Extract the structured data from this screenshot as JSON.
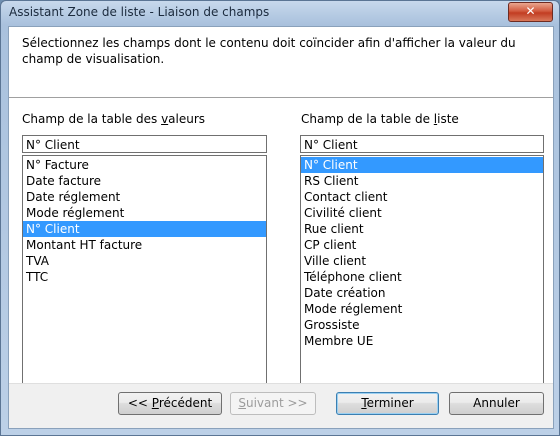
{
  "window": {
    "title": "Assistant Zone de liste - Liaison de champs",
    "close_glyph": "✕"
  },
  "description": "Sélectionnez les champs dont le contenu doit coïncider afin d'afficher la valeur du champ de visualisation.",
  "left": {
    "label_pre": "Champ de la table des ",
    "label_u": "v",
    "label_post": "aleurs",
    "field_value": "N° Client",
    "items": [
      "N° Facture",
      "Date facture",
      "Date réglement",
      "Mode réglement",
      "N° Client",
      "Montant HT facture",
      "TVA",
      "TTC"
    ],
    "selected_index": 4
  },
  "right": {
    "label_pre": "Champ de la table de ",
    "label_u": "l",
    "label_post": "iste",
    "field_value": "N° Client",
    "items": [
      "N° Client",
      "RS Client",
      "Contact client",
      "Civilité client",
      "Rue client",
      "CP client",
      "Ville client",
      "Téléphone client",
      "Date création",
      "Mode réglement",
      "Grossiste",
      "Membre UE"
    ],
    "selected_index": 0
  },
  "buttons": {
    "prev_pre": "<< ",
    "prev_u": "P",
    "prev_post": "récédent",
    "next_u": "S",
    "next_post": "uivant >>",
    "finish_u": "T",
    "finish_post": "erminer",
    "cancel": "Annuler"
  }
}
